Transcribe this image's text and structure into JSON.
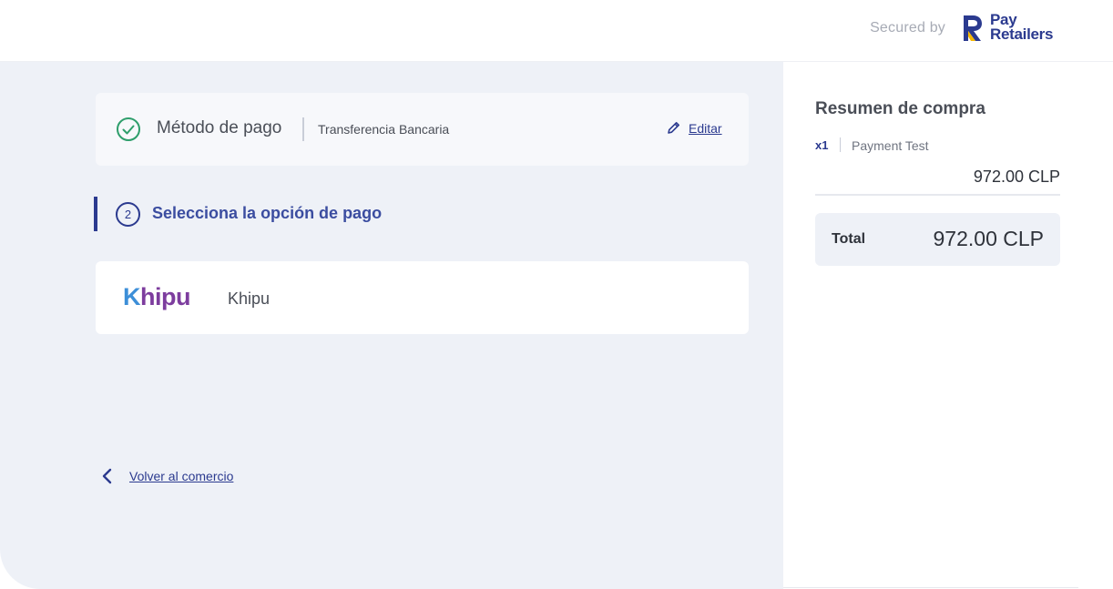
{
  "header": {
    "secured_by": "Secured by",
    "brand_line1": "Pay",
    "brand_line2": "Retailers"
  },
  "payment_method": {
    "title": "Método de pago",
    "value": "Transferencia Bancaria",
    "edit_label": "Editar",
    "status_icon": "check-circle-icon"
  },
  "step": {
    "number": "2",
    "title": "Selecciona la opción de pago"
  },
  "options": [
    {
      "logo_k": "K",
      "logo_rest": "hipu",
      "label": "Khipu"
    }
  ],
  "back_label": "Volver al comercio",
  "summary": {
    "title": "Resumen de compra",
    "quantity": "x1",
    "product": "Payment Test",
    "item_price": "972.00 CLP",
    "total_label": "Total",
    "total_value": "972.00 CLP"
  },
  "colors": {
    "primary": "#2b3a8f",
    "success": "#2e9e6b",
    "background": "#eef1f7",
    "brand_yellow": "#f5b700"
  }
}
